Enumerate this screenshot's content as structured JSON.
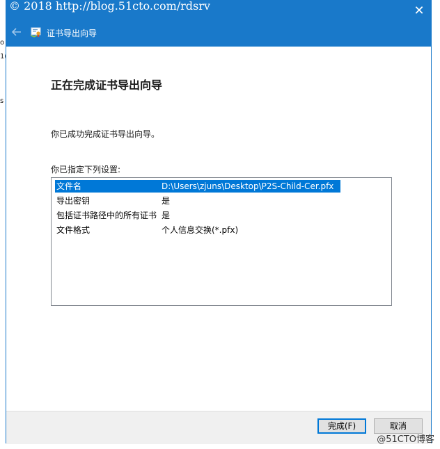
{
  "watermark": "© 2018 http://blog.51cto.com/rdsrv",
  "window": {
    "title": "证书导出向导",
    "close_glyph": "✕"
  },
  "heading": "正在完成证书导出向导",
  "message": "你已成功完成证书导出向导。",
  "list_label": "你已指定下列设置:",
  "settings": [
    {
      "key": "文件名",
      "value": "D:\\Users\\zjuns\\Desktop\\P2S-Child-Cer.pfx",
      "selected": true
    },
    {
      "key": "导出密钥",
      "value": "是",
      "selected": false
    },
    {
      "key": "包括证书路径中的所有证书",
      "value": "是",
      "selected": false
    },
    {
      "key": "文件格式",
      "value": "个人信息交换(*.pfx)",
      "selected": false
    }
  ],
  "buttons": {
    "finish": "完成(F)",
    "cancel": "取消"
  },
  "corner_watermark": "@51CTO博客",
  "colors": {
    "titlebar": "#1979ca",
    "selection": "#0078d7"
  },
  "icons": {
    "back": "back-arrow-icon",
    "app": "certificate-icon",
    "close": "close-icon"
  }
}
